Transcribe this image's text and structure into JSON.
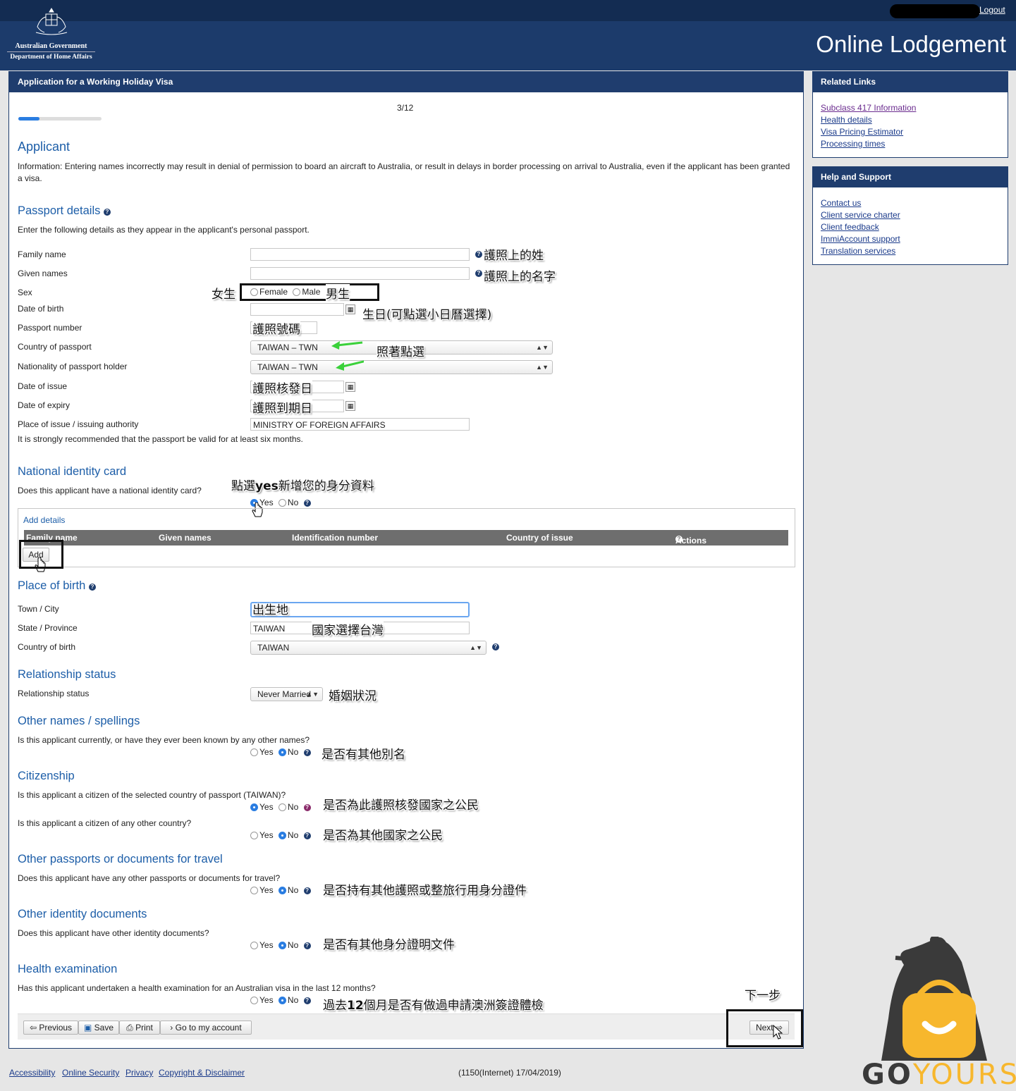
{
  "header": {
    "gov_line1": "Australian Government",
    "gov_line2": "Department of Home Affairs",
    "logout": "Logout",
    "site_title": "Online Lodgement"
  },
  "main": {
    "title": "Application for a Working Holiday Visa",
    "step": "3/12",
    "progress_fraction": 0.25,
    "heading": "Applicant",
    "info": "Information: Entering names incorrectly may result in denial of permission to board an aircraft to Australia, or result in delays in border processing on arrival to Australia, even if the applicant has been granted a visa.",
    "passport": {
      "heading": "Passport details",
      "intro": "Enter the following details as they appear in the applicant's personal passport.",
      "family_name_label": "Family name",
      "given_names_label": "Given names",
      "sex_label": "Sex",
      "sex_female": "Female",
      "sex_male": "Male",
      "dob_label": "Date of birth",
      "passport_number_label": "Passport number",
      "country_label": "Country of passport",
      "country_value": "TAIWAN – TWN",
      "nationality_label": "Nationality of passport holder",
      "nationality_value": "TAIWAN – TWN",
      "issue_label": "Date of issue",
      "expiry_label": "Date of expiry",
      "authority_label": "Place of issue / issuing authority",
      "authority_value": "MINISTRY OF FOREIGN AFFAIRS",
      "validity_note": "It is strongly recommended that the passport be valid for at least six months."
    },
    "nid": {
      "heading": "National identity card",
      "question": "Does this applicant have a national identity card?",
      "yes": "Yes",
      "no": "No",
      "add_details": "Add details",
      "columns": [
        "Family name",
        "Given names",
        "Identification number",
        "Country of issue",
        "Actions"
      ],
      "add_button": "Add"
    },
    "birth": {
      "heading": "Place of birth",
      "town_label": "Town / City",
      "state_label": "State / Province",
      "state_value": "TAIWAN",
      "country_label": "Country of birth",
      "country_value": "TAIWAN"
    },
    "relationship": {
      "heading": "Relationship status",
      "label": "Relationship status",
      "value": "Never Married"
    },
    "other_names": {
      "heading": "Other names / spellings",
      "question": "Is this applicant currently, or have they ever been known by any other names?",
      "yes": "Yes",
      "no": "No"
    },
    "citizenship": {
      "heading": "Citizenship",
      "question1": "Is this applicant a citizen of the selected country of passport (TAIWAN)?",
      "question2": "Is this applicant a citizen of any other country?",
      "yes": "Yes",
      "no": "No"
    },
    "other_passports": {
      "heading": "Other passports or documents for travel",
      "question": "Does this applicant have any other passports or documents for travel?",
      "yes": "Yes",
      "no": "No"
    },
    "other_identity": {
      "heading": "Other identity documents",
      "question": "Does this applicant have other identity documents?",
      "yes": "Yes",
      "no": "No"
    },
    "health": {
      "heading": "Health examination",
      "question": "Has this applicant undertaken a health examination for an Australian visa in the last 12 months?",
      "yes": "Yes",
      "no": "No"
    },
    "nav": {
      "previous": "Previous",
      "save": "Save",
      "print": "Print",
      "account": "Go to my account",
      "next": "Next"
    }
  },
  "related_links": {
    "title": "Related Links",
    "items": [
      "Subclass 417 Information",
      "Health details",
      "Visa Pricing Estimator",
      "Processing times"
    ]
  },
  "help_support": {
    "title": "Help and Support",
    "items": [
      "Contact us",
      "Client service charter",
      "Client feedback",
      "ImmiAccount support",
      "Translation services"
    ]
  },
  "footer": {
    "links": [
      "Accessibility",
      "Online Security",
      "Privacy",
      "Copyright & Disclaimer"
    ],
    "build": "(1150(Internet) 17/04/2019)"
  },
  "annotations": {
    "family_name": "護照上的姓",
    "given_names": "護照上的名字",
    "female": "女生",
    "male": "男生",
    "dob": "生日(可點選小日曆選擇)",
    "passport_number": "護照號碼",
    "select_hint": "照著點選",
    "issue_date": "護照核發日",
    "expiry_date": "護照到期日",
    "nid_hint_pre": "點選",
    "nid_hint_bold": "yes",
    "nid_hint_post": "新增您的身分資料",
    "birthplace": "出生地",
    "country_hint": "國家選擇台灣",
    "marital": "婚姻狀況",
    "other_names": "是否有其他別名",
    "citizen_same": "是否為此護照核發國家之公民",
    "citizen_other": "是否為其他國家之公民",
    "other_passports": "是否持有其他護照或整旅行用身分證件",
    "other_identity": "是否有其他身分證明文件",
    "health_pre": "過去",
    "health_bold": "12",
    "health_post": "個月是否有做過申請澳洲簽證體檢",
    "next_step": "下一步"
  },
  "brand": {
    "wordmark_a": "GO",
    "wordmark_b": "YOURS",
    "accent_color": "#f7b72d"
  },
  "colors": {
    "header_bg": "#1c3b6b",
    "panel_head": "#1f3d6e",
    "section_heading": "#1d5ea8",
    "radio_checked": "#2a7de1",
    "arrow_green": "#3bd13b"
  }
}
